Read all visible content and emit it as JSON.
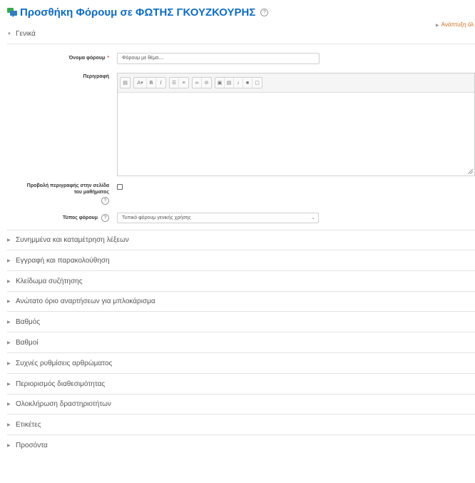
{
  "page": {
    "title": "Προσθήκη Φόρουμ σε ΦΩΤΗΣ ΓΚΟΥΖΚΟΥΡΗΣ",
    "expand_all": "Ανάπτυξη όλ"
  },
  "general": {
    "heading": "Γενικά",
    "forum_name": {
      "label": "Όνομα φόρουμ",
      "required_mark": "*",
      "value": "Φόρουμ με θέμα...."
    },
    "description": {
      "label": "Περιγραφή",
      "toolbar_icons": [
        "toggle-toolbar-icon",
        "font-size-icon",
        "bold-icon",
        "italic-icon",
        "unordered-list-icon",
        "ordered-list-icon",
        "link-icon",
        "unlink-icon",
        "image-icon",
        "media-icon",
        "record-audio-icon",
        "record-video-icon",
        "manage-files-icon"
      ]
    },
    "show_description": {
      "label_line1": "Προβολή περιγραφής στην σελίδα",
      "label_line2": "του μαθήματος",
      "checked": false
    },
    "forum_type": {
      "label": "Τύπος φόρουμ",
      "selected": "Τυπικό φόρουμ γενικής χρήσης"
    }
  },
  "sections": [
    "Συνημμένα και καταμέτρηση λέξεων",
    "Εγγραφή και παρακολούθηση",
    "Κλείδωμα συζήτησης",
    "Ανώτατο όριο αναρτήσεων για μπλοκάρισμα",
    "Βαθμός",
    "Βαθμοί",
    "Συχνές ρυθμίσεις αρθρώματος",
    "Περιορισμός διαθεσιμότητας",
    "Ολοκλήρωση δραστηριοτήτων",
    "Ετικέτες",
    "Προσόντα"
  ],
  "colors": {
    "title": "#0f6cbf",
    "expand_link": "#d06a1a",
    "required": "#d9534f"
  }
}
